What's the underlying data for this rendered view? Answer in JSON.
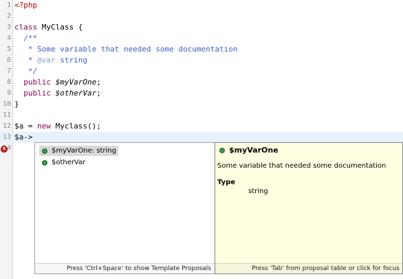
{
  "editor": {
    "lines": [
      {
        "num": "1",
        "parts": [
          {
            "t": "<?php",
            "c": "php-tag"
          }
        ]
      },
      {
        "num": "2",
        "parts": []
      },
      {
        "num": "3",
        "parts": [
          {
            "t": "class",
            "c": "kw"
          },
          {
            "t": " MyClass {",
            "c": ""
          }
        ]
      },
      {
        "num": "4",
        "parts": [
          {
            "t": "  /**",
            "c": "doc"
          }
        ]
      },
      {
        "num": "5",
        "parts": [
          {
            "t": "   * Some variable that needed some documentation",
            "c": "doc"
          }
        ]
      },
      {
        "num": "6",
        "parts": [
          {
            "t": "   * ",
            "c": "doc"
          },
          {
            "t": "@var",
            "c": "doc-tag"
          },
          {
            "t": " string",
            "c": "doc"
          }
        ]
      },
      {
        "num": "7",
        "parts": [
          {
            "t": "   */",
            "c": "doc"
          }
        ]
      },
      {
        "num": "8",
        "parts": [
          {
            "t": "  public",
            "c": "kw"
          },
          {
            "t": " ",
            "c": ""
          },
          {
            "t": "$myVarOne",
            "c": "var"
          },
          {
            "t": ";",
            "c": ""
          }
        ]
      },
      {
        "num": "9",
        "parts": [
          {
            "t": "  public",
            "c": "kw"
          },
          {
            "t": " ",
            "c": ""
          },
          {
            "t": "$otherVar",
            "c": "var"
          },
          {
            "t": ";",
            "c": ""
          }
        ]
      },
      {
        "num": "10",
        "parts": [
          {
            "t": "}",
            "c": ""
          }
        ]
      },
      {
        "num": "11",
        "parts": []
      },
      {
        "num": "12",
        "parts": [
          {
            "t": "$a = ",
            "c": ""
          },
          {
            "t": "new",
            "c": "kw"
          },
          {
            "t": " Myclass();",
            "c": ""
          }
        ]
      },
      {
        "num": "13",
        "parts": [
          {
            "t": "$a->",
            "c": ""
          }
        ],
        "current": true
      },
      {
        "num": "14",
        "parts": [],
        "error": true
      }
    ]
  },
  "proposals": {
    "items": [
      {
        "label": "$myVarOne: string",
        "selected": true
      },
      {
        "label": "$otherVar",
        "selected": false
      }
    ],
    "status": "Press 'Ctrl+Space' to show Template Proposals"
  },
  "doc": {
    "title": "$myVarOne",
    "description": "Some variable that needed some documentation",
    "type_label": "Type",
    "type_value": "string",
    "status": "Press 'Tab' from proposal table or click for focus"
  },
  "colors": {
    "keyword": "#7f0055",
    "doc_comment": "#3f5fbf",
    "php_tag": "#b00000",
    "doc_background": "#ffffe1",
    "field_icon": "#2f9a4a"
  },
  "icons": {
    "field": "public-field-icon",
    "error": "error-marker-icon"
  }
}
